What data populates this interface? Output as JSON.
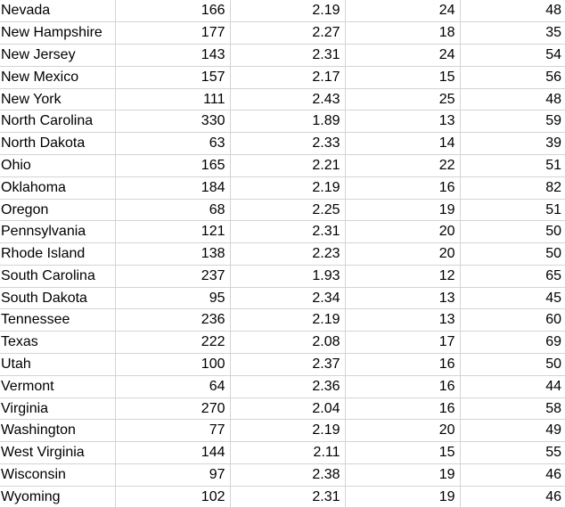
{
  "spreadsheet": {
    "kind": "data-grid",
    "visible_row_count": 23,
    "visible_column_count": 5,
    "grid_line_color": "#d4d4d4",
    "text_color": "#000000",
    "background_color": "#ffffff",
    "columns": [
      {
        "key": "state",
        "align": "left",
        "name": "state-name-column"
      },
      {
        "key": "col2",
        "align": "right",
        "name": "count-column"
      },
      {
        "key": "col3",
        "align": "right",
        "name": "ratio-column"
      },
      {
        "key": "col4",
        "align": "right",
        "name": "small-count-column"
      },
      {
        "key": "col5",
        "align": "right",
        "name": "percent-column"
      }
    ],
    "rows": [
      {
        "state": "Nevada",
        "col2": "166",
        "col3": "2.19",
        "col4": "24",
        "col5": "48"
      },
      {
        "state": "New Hampshire",
        "col2": "177",
        "col3": "2.27",
        "col4": "18",
        "col5": "35"
      },
      {
        "state": "New Jersey",
        "col2": "143",
        "col3": "2.31",
        "col4": "24",
        "col5": "54"
      },
      {
        "state": "New Mexico",
        "col2": "157",
        "col3": "2.17",
        "col4": "15",
        "col5": "56"
      },
      {
        "state": "New York",
        "col2": "111",
        "col3": "2.43",
        "col4": "25",
        "col5": "48"
      },
      {
        "state": "North Carolina",
        "col2": "330",
        "col3": "1.89",
        "col4": "13",
        "col5": "59"
      },
      {
        "state": "North Dakota",
        "col2": "63",
        "col3": "2.33",
        "col4": "14",
        "col5": "39"
      },
      {
        "state": "Ohio",
        "col2": "165",
        "col3": "2.21",
        "col4": "22",
        "col5": "51"
      },
      {
        "state": "Oklahoma",
        "col2": "184",
        "col3": "2.19",
        "col4": "16",
        "col5": "82"
      },
      {
        "state": "Oregon",
        "col2": "68",
        "col3": "2.25",
        "col4": "19",
        "col5": "51"
      },
      {
        "state": "Pennsylvania",
        "col2": "121",
        "col3": "2.31",
        "col4": "20",
        "col5": "50"
      },
      {
        "state": "Rhode Island",
        "col2": "138",
        "col3": "2.23",
        "col4": "20",
        "col5": "50"
      },
      {
        "state": "South Carolina",
        "col2": "237",
        "col3": "1.93",
        "col4": "12",
        "col5": "65"
      },
      {
        "state": "South Dakota",
        "col2": "95",
        "col3": "2.34",
        "col4": "13",
        "col5": "45"
      },
      {
        "state": "Tennessee",
        "col2": "236",
        "col3": "2.19",
        "col4": "13",
        "col5": "60"
      },
      {
        "state": "Texas",
        "col2": "222",
        "col3": "2.08",
        "col4": "17",
        "col5": "69"
      },
      {
        "state": "Utah",
        "col2": "100",
        "col3": "2.37",
        "col4": "16",
        "col5": "50"
      },
      {
        "state": "Vermont",
        "col2": "64",
        "col3": "2.36",
        "col4": "16",
        "col5": "44"
      },
      {
        "state": "Virginia",
        "col2": "270",
        "col3": "2.04",
        "col4": "16",
        "col5": "58"
      },
      {
        "state": "Washington",
        "col2": "77",
        "col3": "2.19",
        "col4": "20",
        "col5": "49"
      },
      {
        "state": "West Virginia",
        "col2": "144",
        "col3": "2.11",
        "col4": "15",
        "col5": "55"
      },
      {
        "state": "Wisconsin",
        "col2": "97",
        "col3": "2.38",
        "col4": "19",
        "col5": "46"
      },
      {
        "state": "Wyoming",
        "col2": "102",
        "col3": "2.31",
        "col4": "19",
        "col5": "46"
      }
    ]
  }
}
